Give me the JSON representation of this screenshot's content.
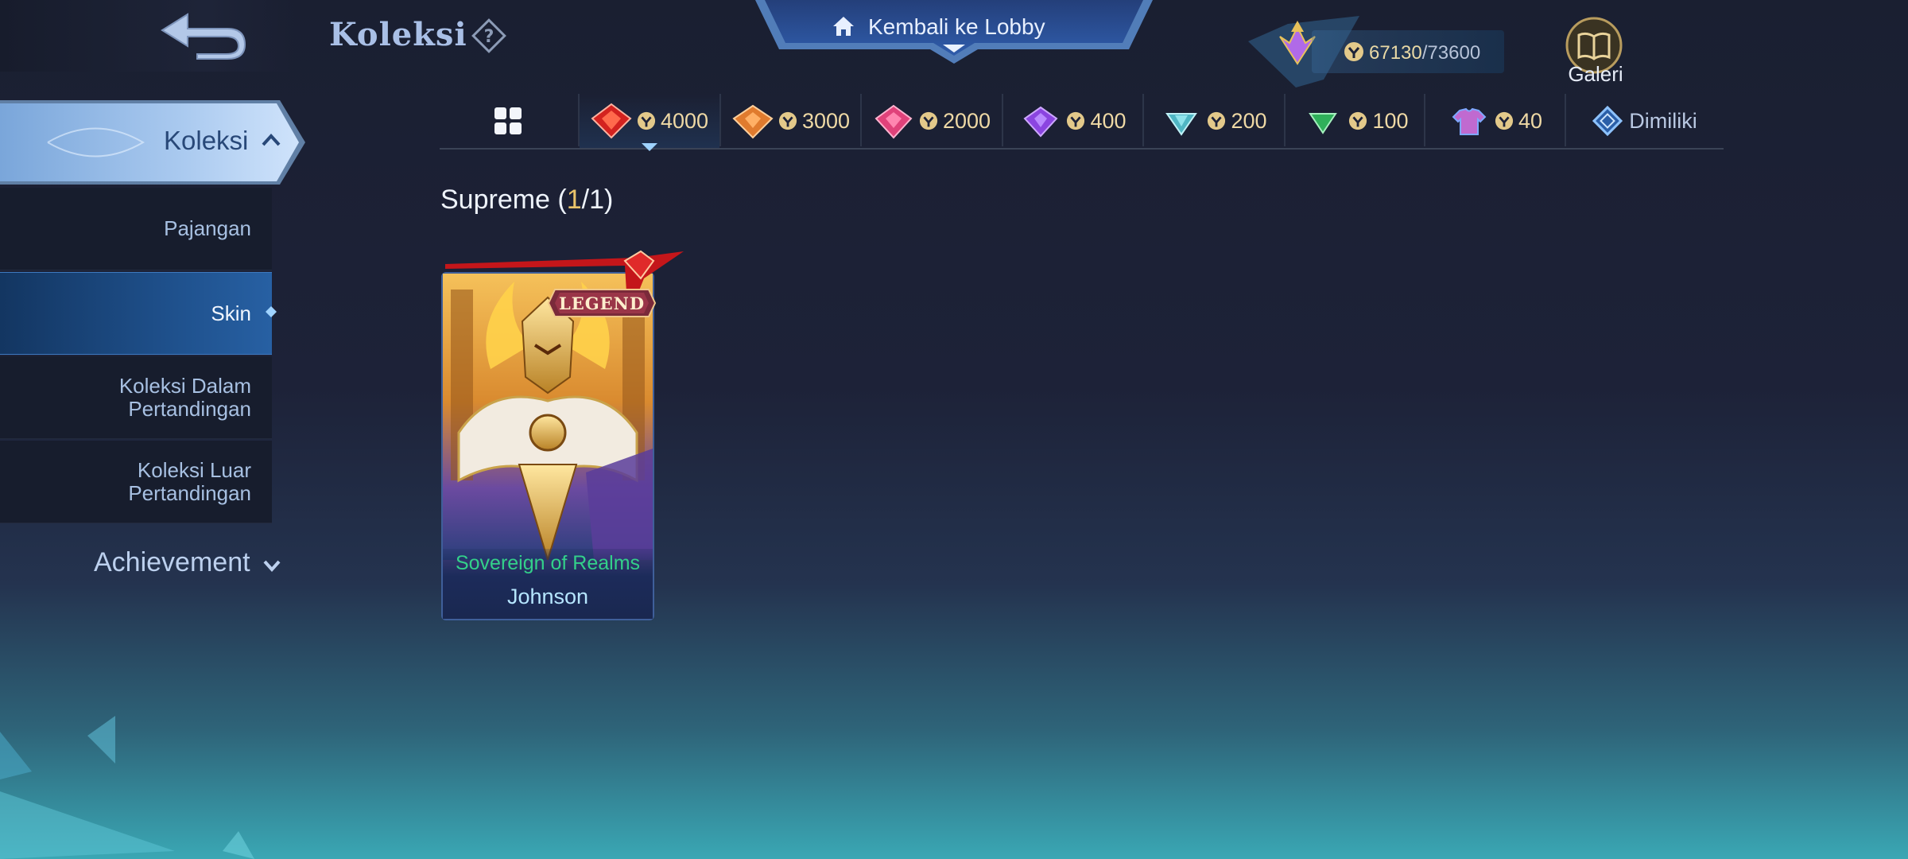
{
  "header": {
    "title": "Koleksi",
    "lobby_label": "Kembali ke Lobby",
    "points_current": "67130",
    "points_separator": "/",
    "points_max": "73600",
    "galeri_label": "Galeri"
  },
  "sidebar": {
    "main_label": "Koleksi",
    "items": [
      {
        "label": "Pajangan"
      },
      {
        "label": "Skin"
      },
      {
        "label": "Koleksi Dalam Pertandingan"
      },
      {
        "label": "Koleksi Luar Pertandingan"
      }
    ],
    "achievement_label": "Achievement"
  },
  "tabs": [
    {
      "value": "4000",
      "gem_color": "#d3221f"
    },
    {
      "value": "3000",
      "gem_color": "#e07b2e"
    },
    {
      "value": "2000",
      "gem_color": "#e0427a"
    },
    {
      "value": "400",
      "gem_color": "#8b45e0"
    },
    {
      "value": "200",
      "gem_color": "#4fb6c4"
    },
    {
      "value": "100",
      "gem_color": "#2fb05a"
    },
    {
      "value": "40",
      "gem_color": "#c06ad0"
    },
    {
      "label": "Dimiliki"
    }
  ],
  "section": {
    "title": "Supreme",
    "open": " (",
    "owned": "1",
    "rest": "/1)"
  },
  "card": {
    "badge": "LEGEND",
    "skin_name": "Sovereign of Realms",
    "hero_name": "Johnson"
  },
  "colors": {
    "accent_gold": "#efd9a5",
    "skin_name_green": "#33d08a",
    "active_blue": "#2760a3"
  }
}
